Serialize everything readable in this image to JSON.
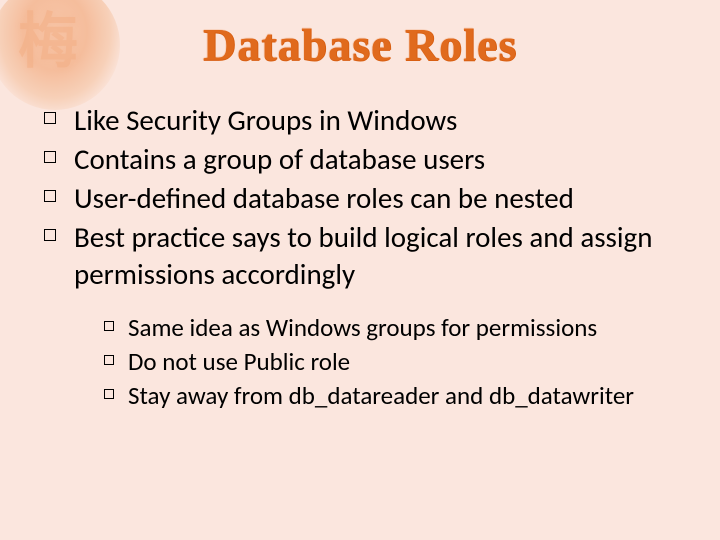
{
  "ornament_glyph": "梅",
  "title": "Database Roles",
  "bullets_lvl1": [
    "Like Security Groups in Windows",
    "Contains a group of database users",
    "User-defined database roles can be nested",
    "Best practice says to build logical roles and assign permissions accordingly"
  ],
  "bullets_lvl2": [
    "Same idea as Windows groups for permissions",
    "Do not use Public role",
    "Stay away from db_datareader and db_datawriter"
  ]
}
